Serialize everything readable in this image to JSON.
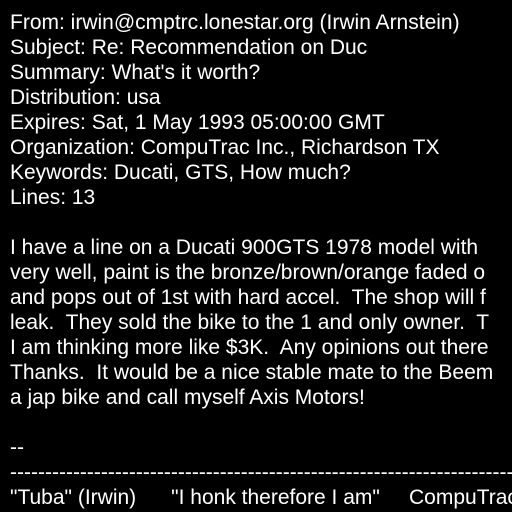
{
  "message": {
    "headers": [
      "From: irwin@cmptrc.lonestar.org (Irwin Arnstein)",
      "Subject: Re: Recommendation on Duc",
      "Summary: What's it worth?",
      "Distribution: usa",
      "Expires: Sat, 1 May 1993 05:00:00 GMT",
      "Organization: CompuTrac Inc., Richardson TX",
      "Keywords: Ducati, GTS, How much?",
      "Lines: 13"
    ],
    "body": [
      "I have a line on a Ducati 900GTS 1978 model with",
      "very well, paint is the bronze/brown/orange faded o",
      "and pops out of 1st with hard accel.  The shop will f",
      "leak.  They sold the bike to the 1 and only owner.  T",
      "I am thinking more like $3K.  Any opinions out there",
      "Thanks.  It would be a nice stable mate to the Beem",
      "a jap bike and call myself Axis Motors!"
    ],
    "signature": {
      "delimiter": "--",
      "rule": "------------------------------------------------------------------------------------",
      "tagline": "\"Tuba\" (Irwin)      \"I honk therefore I am\"     CompuTrac"
    }
  },
  "colors": {
    "background": "#000000",
    "text": "#ffffff"
  }
}
